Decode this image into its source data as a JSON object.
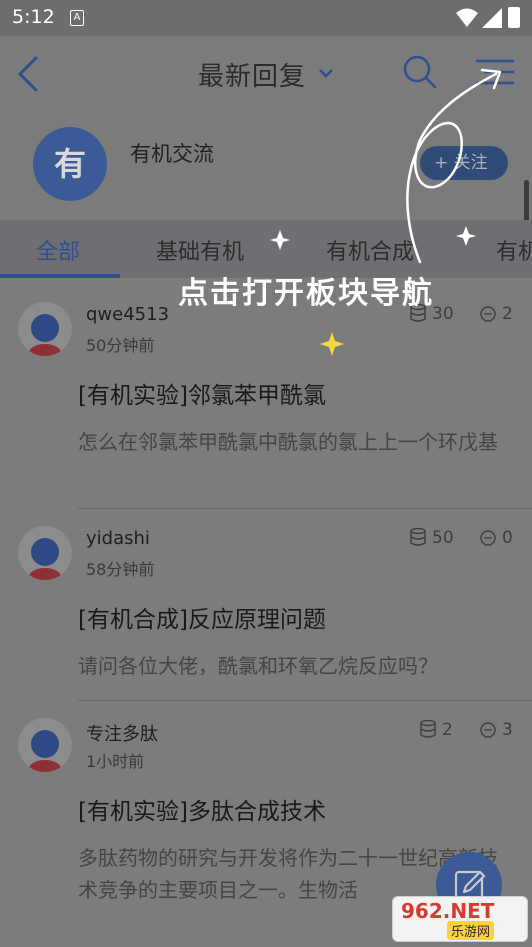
{
  "status_bar": {
    "time": "5:12",
    "notification_icon": "A"
  },
  "nav": {
    "title": "最新回复"
  },
  "forum": {
    "avatar_char": "有",
    "name": "有机交流",
    "follow_label": "+ 关注"
  },
  "tabs": [
    {
      "label": "全部",
      "active": true
    },
    {
      "label": "基础有机",
      "active": false
    },
    {
      "label": "有机合成",
      "active": false
    },
    {
      "label": "有机",
      "active": false
    }
  ],
  "posts": [
    {
      "user": "qwe4513",
      "time": "50分钟前",
      "coins": "30",
      "comments": "2",
      "title": "[有机实验]邻氯苯甲酰氯",
      "body": "怎么在邻氯苯甲酰氯中酰氯的氯上上一个环戊基"
    },
    {
      "user": "yidashi",
      "time": "58分钟前",
      "coins": "50",
      "comments": "0",
      "title": "[有机合成]反应原理问题",
      "body": "请问各位大佬，酰氯和环氧乙烷反应吗？"
    },
    {
      "user": "专注多肽",
      "time": "1小时前",
      "coins": "2",
      "comments": "3",
      "title": "[有机实验]多肽合成技术",
      "body": "多肽药物的研究与开发将作为二十一世纪高新技术竞争的主要项目之一。生物活"
    }
  ],
  "overlay": {
    "hint": "点击打开板块导航"
  },
  "watermark": {
    "main": "962.NET",
    "sub": "乐游网"
  },
  "colors": {
    "accent": "#2f4f8f",
    "overlay_dim": "#7b7b7b",
    "sparkle": "#f5d63d"
  }
}
